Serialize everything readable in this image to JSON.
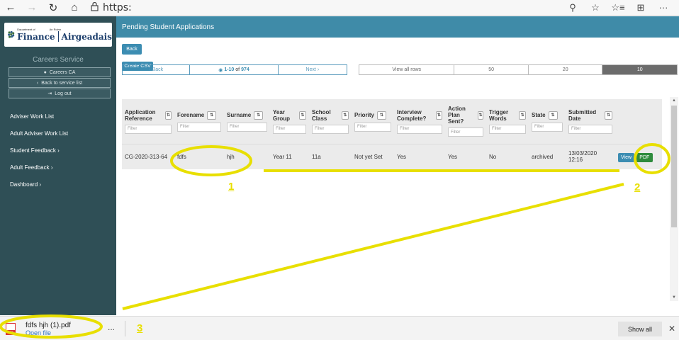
{
  "browser": {
    "url": "https:",
    "back_icon": "←",
    "forward_icon": "→",
    "refresh_icon": "↻",
    "home_icon": "⌂",
    "lock_icon": "🔒",
    "zoom_icon": "🔍",
    "favorite_icon": "☆",
    "favorites_bar_icon": "☆≡",
    "collections_icon": "⊞",
    "more_icon": "···"
  },
  "sidebar": {
    "logo_department": "Department of",
    "logo_ranna": "An Roinn",
    "logo_finance": "Finance",
    "logo_airgeadais": "Airgeadais",
    "service_title": "Careers Service",
    "user_button": "Careers CA",
    "back_button": "Back to service list",
    "logout_button": "Log out",
    "menu": [
      {
        "label": "Adviser Work List"
      },
      {
        "label": "Adult Adviser Work List"
      },
      {
        "label": "Student Feedback"
      },
      {
        "label": "Adult Feedback"
      },
      {
        "label": "Dashboard"
      }
    ]
  },
  "main": {
    "header": "Pending Student Applications",
    "back_button": "Back",
    "csv_button": "Create CSV",
    "pager": {
      "back": "Back",
      "range_bold": "1-10",
      "range_of": "of",
      "range_total": "974",
      "next": "Next"
    },
    "row_options": [
      "View all rows",
      "50",
      "20",
      "10"
    ],
    "selected_row_option": "10",
    "columns": [
      "Application Reference",
      "Forename",
      "Surname",
      "Year Group",
      "School Class",
      "Priority",
      "Interview Complete?",
      "Action Plan Sent?",
      "Trigger Words",
      "State",
      "Submitted Date"
    ],
    "filter_placeholder": "Filter",
    "rows": [
      {
        "cells": [
          "CG-2020-313-64",
          "fdfs",
          "hjh",
          "Year 11",
          "11a",
          "Not yet Set",
          "Yes",
          "Yes",
          "No",
          "archived",
          "13/03/2020 12:16"
        ],
        "view_label": "View",
        "pdf_label": "PDF"
      }
    ]
  },
  "download": {
    "file_name": "fdfs hjh (1).pdf",
    "open_label": "Open file",
    "more": "...",
    "show_all": "Show all",
    "close": "✕"
  },
  "annotations": {
    "n1": "1",
    "n2": "2",
    "n3": "3",
    "color": "#e8df00"
  }
}
